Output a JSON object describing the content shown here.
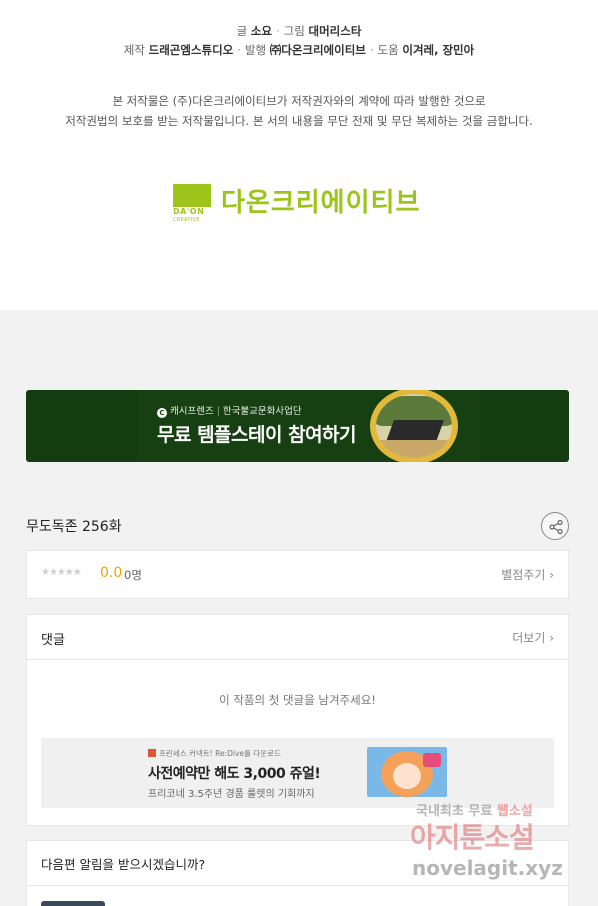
{
  "credits": {
    "writer_label": "글",
    "writer": "소요",
    "artist_label": "그림",
    "artist": "대머리스타",
    "production_label": "제작",
    "production": "드래곤엠스튜디오",
    "publisher_label": "발행",
    "publisher": "㈜다온크리에이티브",
    "assist_label": "도움",
    "assist": "이겨레, 장민아"
  },
  "notice": {
    "line1": "본 저작물은 (주)다온크리에이티브가 저작권자와의 계약에 따라 발행한 것으로",
    "line2": "저작권법의 보호를 받는 저작물입니다. 본 서의 내용을 무단 전재 및 무단 복제하는 것을 금합니다."
  },
  "logo": {
    "mark": "DA'ON",
    "mark_sub": "CREATIVE",
    "name": "다온크리에이티브",
    "color": "#9dc41a"
  },
  "banner": {
    "brand": "캐시프렌즈",
    "sponsor": "한국불교문화사업단",
    "title": "무료 템플스테이 참여하기",
    "bg_color": "#133d10"
  },
  "episode": {
    "title": "무도독존 256화",
    "share_icon": "share-icon"
  },
  "rating": {
    "stars": "★★★★★",
    "score": "0.0",
    "count": "0명",
    "rate_label": "별점주기 ›",
    "score_color": "#f2a100"
  },
  "comments": {
    "title": "댓글",
    "more_label": "더보기 ›",
    "empty_message": "이 작품의 첫 댓글을 남겨주세요!"
  },
  "ad": {
    "small": "프린세스 커넥트! Re:Dive를 다운로드",
    "title": "사전예약만 해도 3,000 쥬얼!",
    "desc": "프리코네 3.5주년 경품 룰렛의 기회까지"
  },
  "notify": {
    "title": "다음편 알림을 받으시겠습니까?"
  },
  "watermark": {
    "line1_a": "국내최초 무료",
    "line1_b": "웹소설",
    "line2": "아지툰소설",
    "line3": "novelagit.xyz"
  }
}
